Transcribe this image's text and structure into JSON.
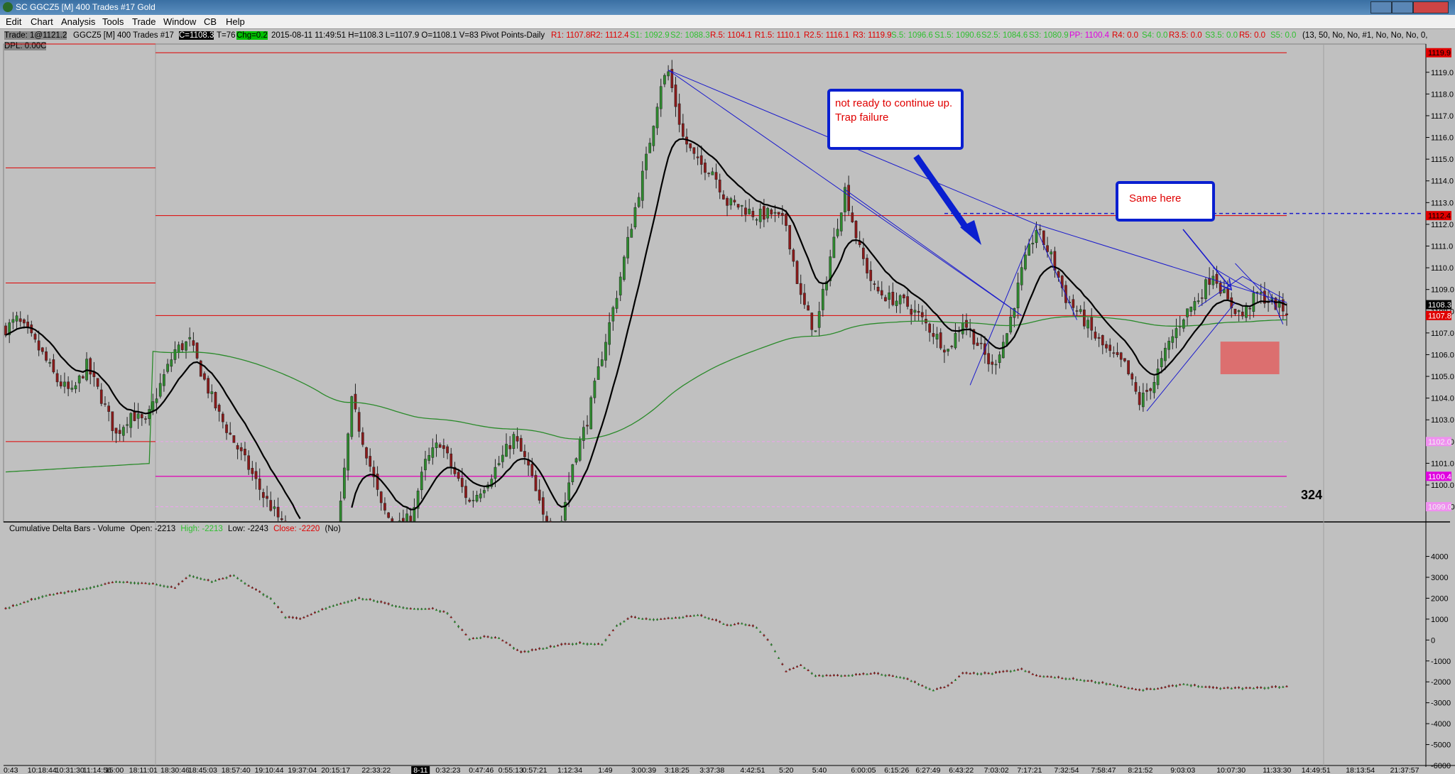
{
  "window": {
    "title": "SC GGCZ5 [M]  400 Trades  #17  Gold"
  },
  "menu": [
    "Edit",
    "Chart",
    "Analysis",
    "Tools",
    "Trade",
    "Window",
    "CB",
    "Help"
  ],
  "infobar": {
    "trade": "Trade: 1@1121.2",
    "symbol": "GGCZ5 [M]  400 Trades  #17",
    "close": "C=1108.3",
    "ticks": "T=76",
    "change": "Chg=0.2",
    "ohlc": "2015-08-11 11:49:51 H=1108.3 L=1107.9 O=1108.1 V=83 Pivot Points-Daily",
    "r1": "R1: 1107.8",
    "r2": "R2: 1112.4",
    "s1": "S1: 1092.9",
    "s2": "S2: 1088.3",
    "r05": "R.5: 1104.1",
    "r15": "R1.5: 1110.1",
    "r25": "R2.5: 1116.1",
    "r3": "R3: 1119.9",
    "s5": "S.5: 1096.6",
    "s15": "S1.5: 1090.6",
    "s25": "S2.5: 1084.6",
    "s3": "S3: 1080.9",
    "pp": "PP: 1100.4",
    "r4": "R4: 0.0",
    "s4": "S4: 0.0",
    "r35": "R3.5: 0.0",
    "s35": "S3.5: 0.0",
    "r5": "R5: 0.0",
    "s5b": "S5: 0.0",
    "params": "(13, 50, No, No, #1, No, No, No, 0,",
    "dpl": "DPL: 0.00C"
  },
  "colors": {
    "background": "#c0c0c0",
    "bull": "#2e8b2e",
    "bear": "#8b1a1a",
    "pivot_red": "#e00000",
    "pivot_magenta": "#e000e0",
    "ma_fast": "#000000",
    "ma_slow": "#2a8a2a",
    "trendline": "#1a1acc",
    "annotation_border": "#0a1fd0",
    "annotation_text": "#e00000",
    "shaded_zone": "#e06060"
  },
  "annotations": {
    "note1": "not ready to continue up.  Trap failure",
    "note2": "Same here",
    "count": "324"
  },
  "lower_panel": {
    "title": "Cumulative Delta Bars - Volume",
    "open": "Open: -2213",
    "high": "High: -2213",
    "low": "Low: -2243",
    "close": "Close: -2220",
    "extra": "(No)"
  },
  "price_axis_labels": {
    "r3": "1119.9",
    "r2": "1112.4",
    "current": "1108.3",
    "r1": "1107.8",
    "pp": "1100.4",
    "pink1": "1102.0",
    "pink2": "1099.0"
  },
  "chart_data": [
    {
      "type": "candlestick",
      "title": "GGCZ5 [M] 400 Trades Gold",
      "ylim": [
        1098.3,
        1120.3
      ],
      "y_ticks": [
        1099.0,
        1100.0,
        1101.0,
        1102.0,
        1103.0,
        1104.0,
        1105.0,
        1106.0,
        1107.0,
        1108.0,
        1109.0,
        1110.0,
        1111.0,
        1112.0,
        1113.0,
        1114.0,
        1115.0,
        1116.0,
        1117.0,
        1118.0,
        1119.0
      ],
      "x_ticks": [
        "0:43",
        "10:18:44",
        "10:31:30",
        "11:14:56",
        "15:00",
        "18:11:01",
        "18:30:46",
        "18:45:03",
        "18:57:40",
        "19:10:44",
        "19:37:04",
        "20:15:17",
        "22:33:22",
        "8-11",
        "0:32:23",
        "0:47:46",
        "0:55:13",
        "0:57:21",
        "1:12:34",
        "1:49",
        "3:00:39",
        "3:18:25",
        "3:37:38",
        "4:42:51",
        "5:20",
        "5:40",
        "6:00:05",
        "6:15:26",
        "6:27:49",
        "6:43:22",
        "7:03:02",
        "7:17:21",
        "7:32:54",
        "7:58:47",
        "8:21:52",
        "9:03:03",
        "10:07:30",
        "11:33:30",
        "14:49:51",
        "18:13:54",
        "21:37:57"
      ],
      "close_path": [
        [
          0,
          1107.2
        ],
        [
          3,
          1107.6
        ],
        [
          6,
          1107.0
        ],
        [
          10,
          1106.0
        ],
        [
          14,
          1104.8
        ],
        [
          18,
          1104.2
        ],
        [
          22,
          1105.5
        ],
        [
          26,
          1104.0
        ],
        [
          30,
          1102.3
        ],
        [
          34,
          1103.3
        ],
        [
          38,
          1102.8
        ],
        [
          42,
          1104.6
        ],
        [
          46,
          1106.2
        ],
        [
          50,
          1106.6
        ],
        [
          54,
          1104.8
        ],
        [
          58,
          1103.2
        ],
        [
          62,
          1102.0
        ],
        [
          66,
          1100.8
        ],
        [
          70,
          1099.5
        ],
        [
          74,
          1098.5
        ],
        [
          78,
          1097.2
        ],
        [
          82,
          1096.0
        ],
        [
          86,
          1094.0
        ],
        [
          90,
          1097.5
        ],
        [
          94,
          1103.8
        ],
        [
          98,
          1101.5
        ],
        [
          102,
          1099.0
        ],
        [
          106,
          1098.0
        ],
        [
          110,
          1098.5
        ],
        [
          114,
          1101.0
        ],
        [
          118,
          1102.0
        ],
        [
          122,
          1100.5
        ],
        [
          126,
          1099.2
        ],
        [
          130,
          1100.0
        ],
        [
          134,
          1101.0
        ],
        [
          138,
          1102.2
        ],
        [
          142,
          1100.8
        ],
        [
          146,
          1098.5
        ],
        [
          150,
          1097.5
        ],
        [
          154,
          1101.0
        ],
        [
          158,
          1103.0
        ],
        [
          162,
          1106.0
        ],
        [
          166,
          1108.8
        ],
        [
          170,
          1112.0
        ],
        [
          174,
          1115.0
        ],
        [
          178,
          1118.5
        ],
        [
          180,
          1119.0
        ],
        [
          184,
          1116.0
        ],
        [
          188,
          1114.8
        ],
        [
          192,
          1114.5
        ],
        [
          196,
          1113.0
        ],
        [
          200,
          1112.8
        ],
        [
          204,
          1112.4
        ],
        [
          208,
          1112.5
        ],
        [
          212,
          1112.0
        ],
        [
          216,
          1108.6
        ],
        [
          220,
          1107.0
        ],
        [
          224,
          1110.5
        ],
        [
          228,
          1113.6
        ],
        [
          232,
          1110.8
        ],
        [
          236,
          1109.0
        ],
        [
          240,
          1108.6
        ],
        [
          244,
          1108.4
        ],
        [
          248,
          1107.8
        ],
        [
          252,
          1107.0
        ],
        [
          256,
          1106.2
        ],
        [
          260,
          1107.6
        ],
        [
          264,
          1106.5
        ],
        [
          268,
          1105.4
        ],
        [
          272,
          1107.0
        ],
        [
          276,
          1109.8
        ],
        [
          280,
          1111.8
        ],
        [
          284,
          1110.5
        ],
        [
          288,
          1108.6
        ],
        [
          292,
          1107.8
        ],
        [
          296,
          1106.8
        ],
        [
          300,
          1106.0
        ],
        [
          304,
          1105.5
        ],
        [
          308,
          1103.8
        ],
        [
          312,
          1104.8
        ],
        [
          316,
          1106.5
        ],
        [
          320,
          1107.8
        ],
        [
          324,
          1108.6
        ],
        [
          328,
          1109.8
        ],
        [
          332,
          1108.4
        ],
        [
          336,
          1107.8
        ],
        [
          340,
          1108.8
        ],
        [
          344,
          1108.4
        ],
        [
          348,
          1108.0
        ]
      ],
      "series": [
        {
          "name": "Pivot R3",
          "value": 1119.9
        },
        {
          "name": "Pivot R2",
          "value": 1112.4
        },
        {
          "name": "Pivot R1",
          "value": 1107.8
        },
        {
          "name": "Pivot PP",
          "value": 1100.4
        }
      ]
    },
    {
      "type": "bar",
      "title": "Cumulative Delta Bars - Volume",
      "ylim": [
        -6000,
        4800
      ],
      "y_ticks": [
        4000,
        3000,
        2000,
        1000,
        0,
        -1000,
        -2000,
        -3000,
        -4000,
        -5000,
        -6000
      ],
      "values_path": [
        [
          0,
          1500
        ],
        [
          10,
          2100
        ],
        [
          20,
          2400
        ],
        [
          30,
          2800
        ],
        [
          40,
          2700
        ],
        [
          46,
          2500
        ],
        [
          50,
          3100
        ],
        [
          56,
          2800
        ],
        [
          62,
          3100
        ],
        [
          66,
          2600
        ],
        [
          72,
          2000
        ],
        [
          76,
          1100
        ],
        [
          80,
          1000
        ],
        [
          84,
          1300
        ],
        [
          88,
          1600
        ],
        [
          92,
          1800
        ],
        [
          96,
          2000
        ],
        [
          100,
          1900
        ],
        [
          104,
          1700
        ],
        [
          110,
          1500
        ],
        [
          116,
          1500
        ],
        [
          120,
          1300
        ],
        [
          126,
          50
        ],
        [
          130,
          150
        ],
        [
          134,
          100
        ],
        [
          140,
          -600
        ],
        [
          146,
          -400
        ],
        [
          152,
          -200
        ],
        [
          156,
          -150
        ],
        [
          162,
          -200
        ],
        [
          166,
          700
        ],
        [
          170,
          1100
        ],
        [
          174,
          1000
        ],
        [
          178,
          1000
        ],
        [
          184,
          1100
        ],
        [
          188,
          1200
        ],
        [
          192,
          1000
        ],
        [
          196,
          700
        ],
        [
          200,
          800
        ],
        [
          204,
          600
        ],
        [
          208,
          -200
        ],
        [
          212,
          -1500
        ],
        [
          216,
          -1200
        ],
        [
          220,
          -1700
        ],
        [
          228,
          -1700
        ],
        [
          236,
          -1600
        ],
        [
          244,
          -1800
        ],
        [
          252,
          -2400
        ],
        [
          256,
          -2200
        ],
        [
          260,
          -1600
        ],
        [
          268,
          -1600
        ],
        [
          276,
          -1400
        ],
        [
          280,
          -1700
        ],
        [
          286,
          -1800
        ],
        [
          292,
          -1900
        ],
        [
          300,
          -2100
        ],
        [
          308,
          -2400
        ],
        [
          314,
          -2300
        ],
        [
          320,
          -2100
        ],
        [
          328,
          -2300
        ],
        [
          334,
          -2300
        ],
        [
          340,
          -2300
        ],
        [
          348,
          -2220
        ]
      ]
    }
  ]
}
